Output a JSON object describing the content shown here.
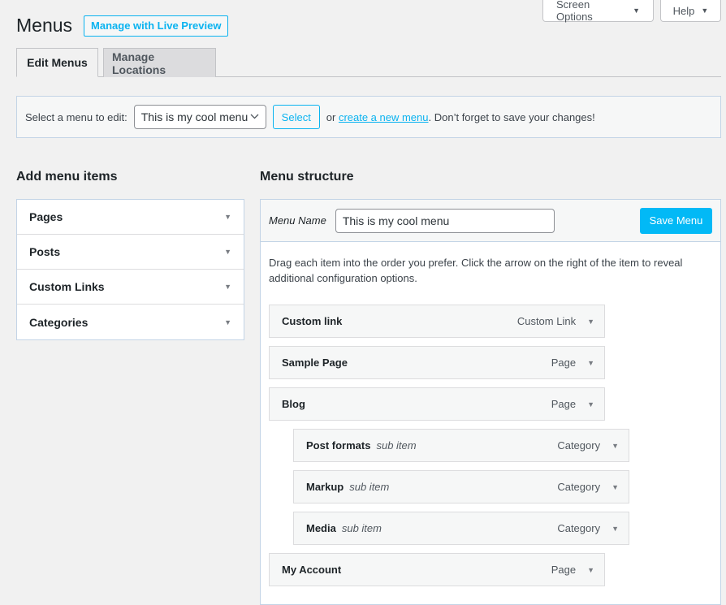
{
  "header": {
    "title": "Menus",
    "live_preview_label": "Manage with Live Preview",
    "screen_options_label": "Screen Options",
    "help_label": "Help"
  },
  "tabs": [
    {
      "label": "Edit Menus",
      "active": true
    },
    {
      "label": "Manage Locations",
      "active": false
    }
  ],
  "select_bar": {
    "prompt": "Select a menu to edit:",
    "selected_menu": "This is my cool menu",
    "select_button": "Select",
    "or_text": "or",
    "create_link": "create a new menu",
    "suffix": ". Don’t forget to save your changes!"
  },
  "add_items": {
    "title": "Add menu items",
    "sections": [
      "Pages",
      "Posts",
      "Custom Links",
      "Categories"
    ]
  },
  "structure": {
    "title": "Menu structure",
    "menu_name_label": "Menu Name",
    "menu_name_value": "This is my cool menu",
    "save_button": "Save Menu",
    "instructions": "Drag each item into the order you prefer. Click the arrow on the right of the item to reveal additional configuration options.",
    "items": [
      {
        "title": "Custom link",
        "sub": "",
        "type": "Custom Link",
        "depth": 0
      },
      {
        "title": "Sample Page",
        "sub": "",
        "type": "Page",
        "depth": 0
      },
      {
        "title": "Blog",
        "sub": "",
        "type": "Page",
        "depth": 0
      },
      {
        "title": "Post formats",
        "sub": "sub item",
        "type": "Category",
        "depth": 1
      },
      {
        "title": "Markup",
        "sub": "sub item",
        "type": "Category",
        "depth": 1
      },
      {
        "title": "Media",
        "sub": "sub item",
        "type": "Category",
        "depth": 1
      },
      {
        "title": "My Account",
        "sub": "",
        "type": "Page",
        "depth": 0
      }
    ]
  },
  "icons": {
    "caret": "▼",
    "chevron": "⌄"
  },
  "colors": {
    "accent": "#02b9f6",
    "link": "#0ab3f0",
    "background": "#f1f1f1"
  }
}
